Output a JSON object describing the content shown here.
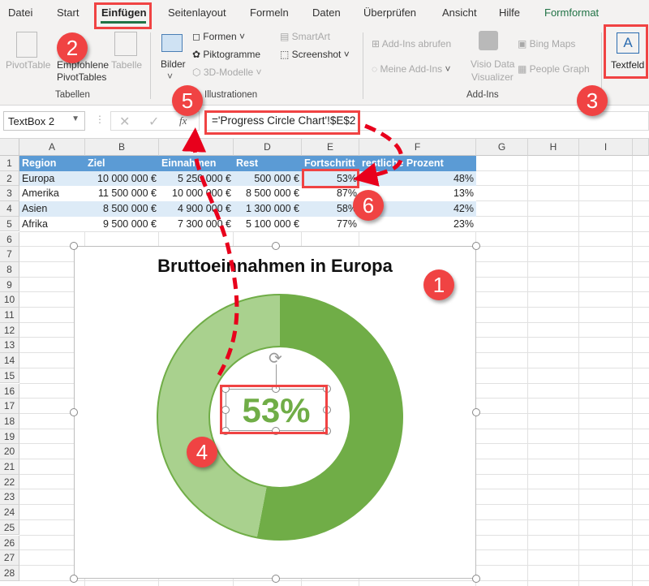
{
  "tabs": [
    "Datei",
    "Start",
    "Einfügen",
    "Seitenlayout",
    "Formeln",
    "Daten",
    "Überprüfen",
    "Ansicht",
    "Hilfe",
    "Formformat"
  ],
  "active_tab": "Einfügen",
  "ribbon": {
    "tabellen": {
      "pivottable": "PivotTable",
      "empfohlene": "Empfohlene",
      "pivottables": "PivotTables",
      "tabelle": "Tabelle",
      "group": "Tabellen"
    },
    "illustrationen": {
      "bilder": "Bilder",
      "formen": "Formen",
      "piktogramme": "Piktogramme",
      "modelle": "3D-Modelle",
      "smartart": "SmartArt",
      "screenshot": "Screenshot",
      "group": "Illustrationen"
    },
    "addins": {
      "abrufen": "Add-Ins abrufen",
      "meine": "Meine Add-Ins",
      "visio1": "Visio Data",
      "visio2": "Visualizer",
      "bing": "Bing Maps",
      "people": "People Graph",
      "group": "Add-Ins"
    },
    "textfeld": "Textfeld"
  },
  "formula_bar": {
    "name_box": "TextBox 2",
    "fx": "fx",
    "formula": "='Progress Circle Chart'!$E$2"
  },
  "columns": [
    "A",
    "B",
    "C",
    "D",
    "E",
    "F",
    "G",
    "H",
    "I"
  ],
  "rows": [
    "1",
    "2",
    "3",
    "4",
    "5",
    "6",
    "7",
    "8",
    "9",
    "10",
    "11",
    "12",
    "13",
    "14",
    "15",
    "16",
    "17",
    "18",
    "19",
    "20",
    "21",
    "22",
    "23",
    "24",
    "25",
    "26",
    "27",
    "28"
  ],
  "table": {
    "headers": [
      "Region",
      "Ziel",
      "Einnahmen",
      "Rest",
      "Fortschritt",
      "restliche Prozent"
    ],
    "rows": [
      [
        "Europa",
        "10 000 000 €",
        "5 250 000 €",
        "500 000 €",
        "53%",
        "48%"
      ],
      [
        "Amerika",
        "11 500 000 €",
        "10 000 000 €",
        "8 500 000 €",
        "87%",
        "13%"
      ],
      [
        "Asien",
        "8 500 000 €",
        "4 900 000 €",
        "1 300 000 €",
        "58%",
        "42%"
      ],
      [
        "Afrika",
        "9 500 000 €",
        "7 300 000 €",
        "5 100 000 €",
        "77%",
        "23%"
      ]
    ]
  },
  "chart": {
    "title": "Bruttoeinnahmen in Europa",
    "progress": 53,
    "textbox": "53%",
    "colors": {
      "progress": "#70ad47",
      "remaining": "#a9d18e"
    }
  },
  "annotations": [
    "1",
    "2",
    "3",
    "4",
    "5",
    "6"
  ],
  "colors": {
    "accent_green": "#217346",
    "annotation_red": "#f04343",
    "table_header": "#5b9bd5",
    "band": "#ddebf7"
  }
}
